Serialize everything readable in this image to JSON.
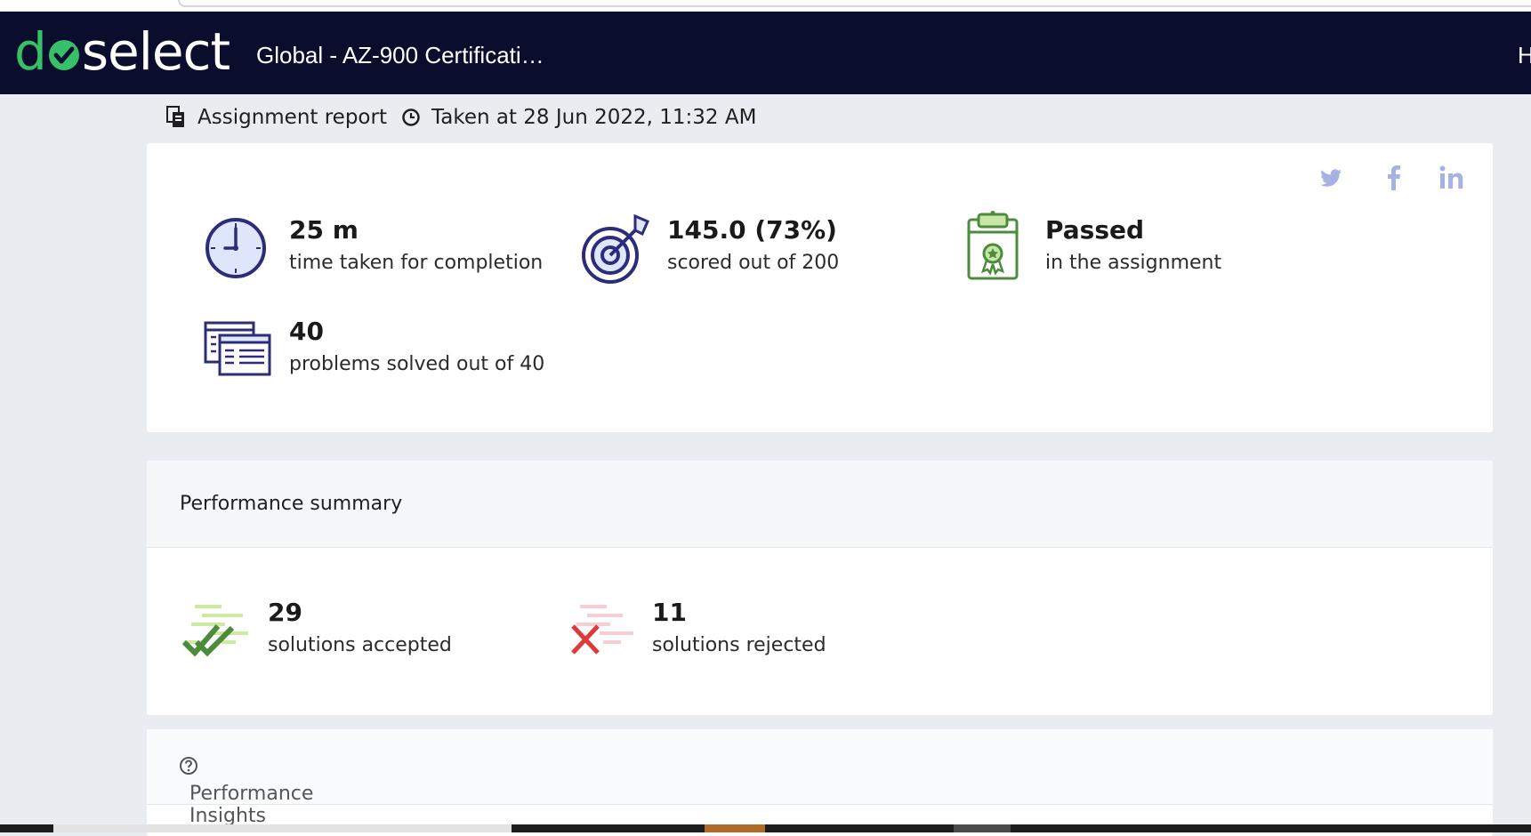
{
  "header": {
    "logo_text_left": "d",
    "logo_text_right": "select",
    "title": "Global - AZ-900 Certificati…",
    "right_text": "H"
  },
  "crumbs": {
    "report_label": "Assignment report",
    "taken_at": "Taken at 28 Jun 2022, 11:32 AM"
  },
  "social": [
    "twitter-icon",
    "facebook-icon",
    "linkedin-icon"
  ],
  "stats": {
    "time": {
      "value": "25 m",
      "label": "time taken for completion"
    },
    "score": {
      "value": "145.0 (73%)",
      "label": "scored out of 200"
    },
    "status": {
      "value": "Passed",
      "label": "in the assignment"
    },
    "problems": {
      "value": "40",
      "label": "problems solved out of 40"
    }
  },
  "performance_summary": {
    "title": "Performance summary",
    "accepted": {
      "value": "29",
      "label": "solutions accepted"
    },
    "rejected": {
      "value": "11",
      "label": "solutions rejected"
    }
  },
  "performance_insights": {
    "title": "Performance Insights"
  },
  "colors": {
    "header_bg": "#0a0e2c",
    "brand_green": "#37c06a",
    "icon_navy": "#2b2d7a",
    "social": "#a7b2e3",
    "accept_green": "#4c8a3c",
    "reject_red": "#e0393b"
  }
}
